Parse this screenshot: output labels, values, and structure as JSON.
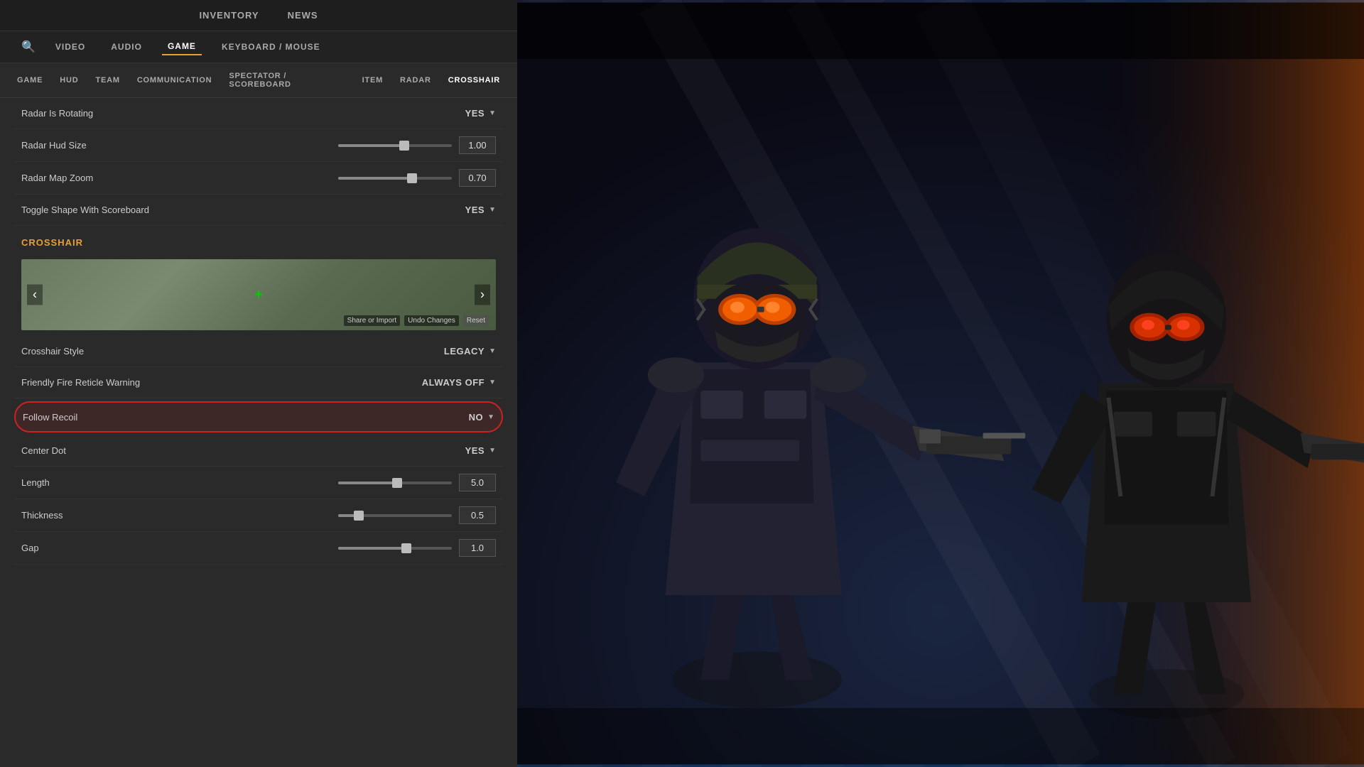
{
  "topNav": {
    "items": [
      {
        "label": "INVENTORY",
        "active": false
      },
      {
        "label": "NEWS",
        "active": false
      }
    ]
  },
  "settingsTabs": {
    "searchPlaceholder": "Search",
    "tabs": [
      {
        "label": "VIDEO",
        "active": false
      },
      {
        "label": "AUDIO",
        "active": false
      },
      {
        "label": "GAME",
        "active": true
      },
      {
        "label": "KEYBOARD / MOUSE",
        "active": false
      }
    ]
  },
  "subTabs": {
    "tabs": [
      {
        "label": "GAME",
        "active": false
      },
      {
        "label": "HUD",
        "active": false
      },
      {
        "label": "TEAM",
        "active": false
      },
      {
        "label": "COMMUNICATION",
        "active": false
      },
      {
        "label": "SPECTATOR / SCOREBOARD",
        "active": false
      },
      {
        "label": "ITEM",
        "active": false
      },
      {
        "label": "RADAR",
        "active": false
      },
      {
        "label": "CROSSHAIR",
        "active": true
      }
    ]
  },
  "radarSettings": [
    {
      "label": "Radar Is Rotating",
      "type": "dropdown",
      "value": "YES"
    },
    {
      "label": "Radar Hud Size",
      "type": "slider",
      "value": "1.00",
      "fillPercent": 58
    },
    {
      "label": "Radar Map Zoom",
      "type": "slider",
      "value": "0.70",
      "fillPercent": 65
    },
    {
      "label": "Toggle Shape With Scoreboard",
      "type": "dropdown",
      "value": "YES"
    }
  ],
  "crosshairSection": {
    "label": "Crosshair",
    "preview": {
      "shareLabel": "Share or Import",
      "undoLabel": "Undo Changes",
      "resetLabel": "Reset"
    },
    "settings": [
      {
        "label": "Crosshair Style",
        "type": "dropdown",
        "value": "LEGACY",
        "highlighted": false
      },
      {
        "label": "Friendly Fire Reticle Warning",
        "type": "dropdown",
        "value": "ALWAYS OFF",
        "highlighted": false
      },
      {
        "label": "Follow Recoil",
        "type": "dropdown",
        "value": "NO",
        "highlighted": true
      },
      {
        "label": "Center Dot",
        "type": "dropdown",
        "value": "YES",
        "highlighted": false
      },
      {
        "label": "Length",
        "type": "slider",
        "value": "5.0",
        "fillPercent": 52
      },
      {
        "label": "Thickness",
        "type": "slider",
        "value": "0.5",
        "fillPercent": 18
      },
      {
        "label": "Gap",
        "type": "slider",
        "value": "1.0",
        "fillPercent": 60
      }
    ]
  }
}
